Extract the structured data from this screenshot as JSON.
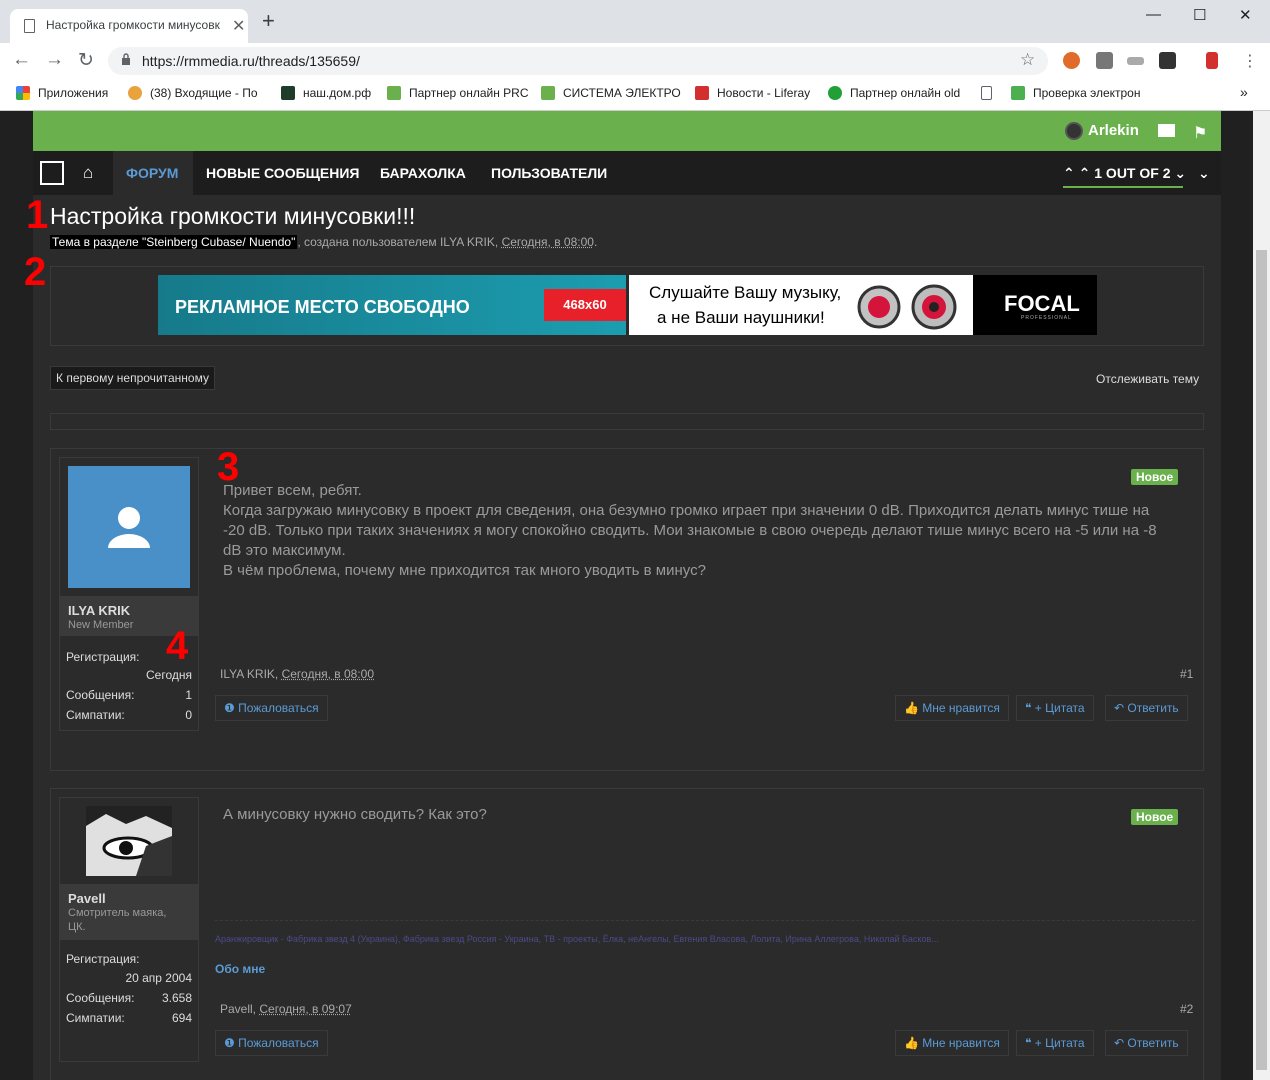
{
  "browser": {
    "tab_title": "Настройка громкости минусовк",
    "url": "https://rmmedia.ru/threads/135659/",
    "bookmarks": [
      {
        "label": "Приложения",
        "color": "#4285f4"
      },
      {
        "label": "(38) Входящие - По",
        "color": "#e8a33d"
      },
      {
        "label": "наш.дом.рф",
        "color": "#1f3b2a"
      },
      {
        "label": "Партнер онлайн PRC",
        "color": "#6ab04c"
      },
      {
        "label": "СИСТЕМА ЭЛЕКТРО",
        "color": "#6ab04c"
      },
      {
        "label": "Новости - Liferay",
        "color": "#d32f2f"
      },
      {
        "label": "Партнер онлайн old",
        "color": "#21a038"
      },
      {
        "label": "",
        "color": "#ffffff"
      },
      {
        "label": "Проверка электрон",
        "color": "#4caf50"
      }
    ]
  },
  "site": {
    "username": "Arlekin",
    "nav": {
      "forum": "ФОРУМ",
      "new_messages": "НОВЫЕ СООБЩЕНИЯ",
      "flea_market": "БАРАХОЛКА",
      "users": "ПОЛЬЗОВАТЕЛИ",
      "pager": "1 OUT OF 2"
    },
    "accent": "#6ab04c"
  },
  "thread": {
    "title": "Настройка громкости минусовки!!!",
    "section": "Тема в разделе \"Steinberg Cubase/ Nuendo\"",
    "created_by": ", создана пользователем ILYA KRIK, ",
    "created_at": "Сегодня, в 08:00",
    "tail": "."
  },
  "ads": {
    "ad1_text": "РЕКЛАМНОЕ  МЕСТО СВОБОДНО",
    "ad1_size": "468x60",
    "ad2_line1": "Слушайте Вашу музыку,",
    "ad2_line2": "а не Ваши наушники!",
    "ad2_brand": "FOCAL",
    "ad2_sub": "PROFESSIONAL"
  },
  "actions": {
    "first_unread": "К первому непрочитанному",
    "watch": "Отслеживать тему"
  },
  "labels": {
    "registration": "Регистрация:",
    "messages": "Сообщения:",
    "likes": "Симпатии:",
    "new_badge": "Новое",
    "report": "Пожаловаться",
    "like": "Мне нравится",
    "quote": "+ Цитата",
    "reply": "Ответить",
    "about": "Обо мне"
  },
  "posts": [
    {
      "author": "ILYA KRIK",
      "title": "New Member",
      "registration": "Сегодня",
      "messages": "1",
      "likes": "0",
      "lines": [
        "Привет всем, ребят.",
        "Когда загружаю минусовку в проект для сведения, она безумно громко играет при значении 0 dB. Приходится делать минус тише на",
        "-20 dB. Только при таких значениях я могу спокойно сводить. Мои знакомые в свою очередь делают тише минус всего на -5 или на -8",
        "dB это максимум.",
        "В чём проблема, почему мне приходится так много уводить в минус?"
      ],
      "meta_author": "ILYA KRIK, ",
      "meta_time": "Сегодня, в 08:00",
      "number": "#1"
    },
    {
      "author": "Pavell",
      "title": "Смотритель маяка, ЦК.",
      "registration": "20 апр 2004",
      "messages": "3.658",
      "likes": "694",
      "lines": [
        "А минусовку нужно сводить? Как это?"
      ],
      "signature": "Аранжировщик - Фабрика звезд 4 (Украина), Фабрика звезд Россия - Украина, ТВ - проекты, Ёлка, неАнгелы, Евгения Власова, Лолита, Ирина Аллегрова, Николай Басков...",
      "meta_author": "Pavell, ",
      "meta_time": "Сегодня, в 09:07",
      "number": "#2"
    }
  ],
  "annotations": [
    "1",
    "2",
    "3",
    "4"
  ]
}
